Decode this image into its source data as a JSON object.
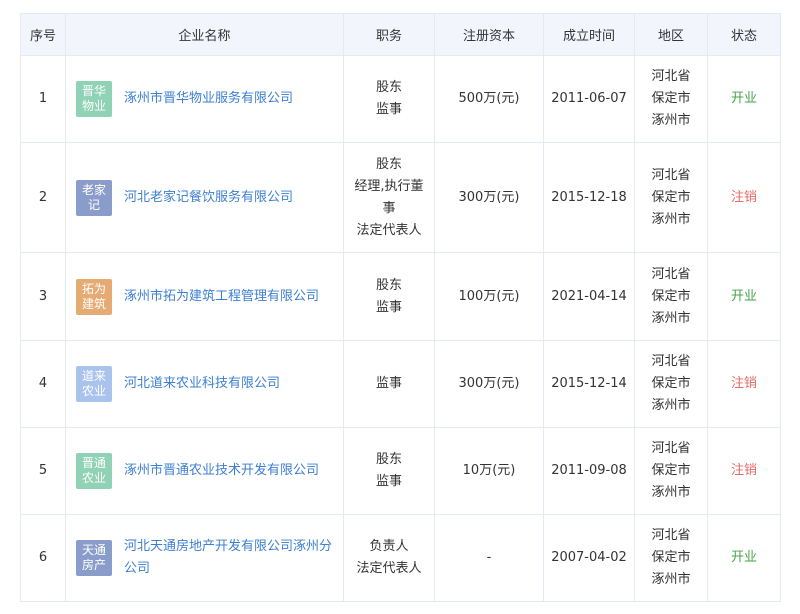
{
  "headers": [
    "序号",
    "企业名称",
    "职务",
    "注册资本",
    "成立时间",
    "地区",
    "状态"
  ],
  "rows": [
    {
      "no": "1",
      "logo": {
        "line1": "晋华",
        "line2": "物业",
        "color": "#8fd2b5"
      },
      "name": "涿州市晋华物业服务有限公司",
      "roles": [
        "股东",
        "监事"
      ],
      "capital": "500万(元)",
      "date": "2011-06-07",
      "region": [
        "河北省",
        "保定市",
        "涿州市"
      ],
      "status": "开业",
      "status_type": "open"
    },
    {
      "no": "2",
      "logo": {
        "line1": "老家",
        "line2": "记",
        "color": "#8a9cc9"
      },
      "name": "河北老家记餐饮服务有限公司",
      "roles": [
        "股东",
        "经理,执行董",
        "事",
        "法定代表人"
      ],
      "capital": "300万(元)",
      "date": "2015-12-18",
      "region": [
        "河北省",
        "保定市",
        "涿州市"
      ],
      "status": "注销",
      "status_type": "closed"
    },
    {
      "no": "3",
      "logo": {
        "line1": "拓为",
        "line2": "建筑",
        "color": "#e5ab73"
      },
      "name": "涿州市拓为建筑工程管理有限公司",
      "roles": [
        "股东",
        "监事"
      ],
      "capital": "100万(元)",
      "date": "2021-04-14",
      "region": [
        "河北省",
        "保定市",
        "涿州市"
      ],
      "status": "开业",
      "status_type": "open"
    },
    {
      "no": "4",
      "logo": {
        "line1": "道来",
        "line2": "农业",
        "color": "#a9c3ec"
      },
      "name": "河北道来农业科技有限公司",
      "roles": [
        "监事"
      ],
      "capital": "300万(元)",
      "date": "2015-12-14",
      "region": [
        "河北省",
        "保定市",
        "涿州市"
      ],
      "status": "注销",
      "status_type": "closed"
    },
    {
      "no": "5",
      "logo": {
        "line1": "晋通",
        "line2": "农业",
        "color": "#8fd2b5"
      },
      "name": "涿州市晋通农业技术开发有限公司",
      "roles": [
        "股东",
        "监事"
      ],
      "capital": "10万(元)",
      "date": "2011-09-08",
      "region": [
        "河北省",
        "保定市",
        "涿州市"
      ],
      "status": "注销",
      "status_type": "closed"
    },
    {
      "no": "6",
      "logo": {
        "line1": "天通",
        "line2": "房产",
        "color": "#8a9cc9"
      },
      "name": "河北天通房地产开发有限公司涿州分公司",
      "roles": [
        "负责人",
        "法定代表人"
      ],
      "capital": "-",
      "date": "2007-04-02",
      "region": [
        "河北省",
        "保定市",
        "涿州市"
      ],
      "status": "开业",
      "status_type": "open"
    }
  ]
}
